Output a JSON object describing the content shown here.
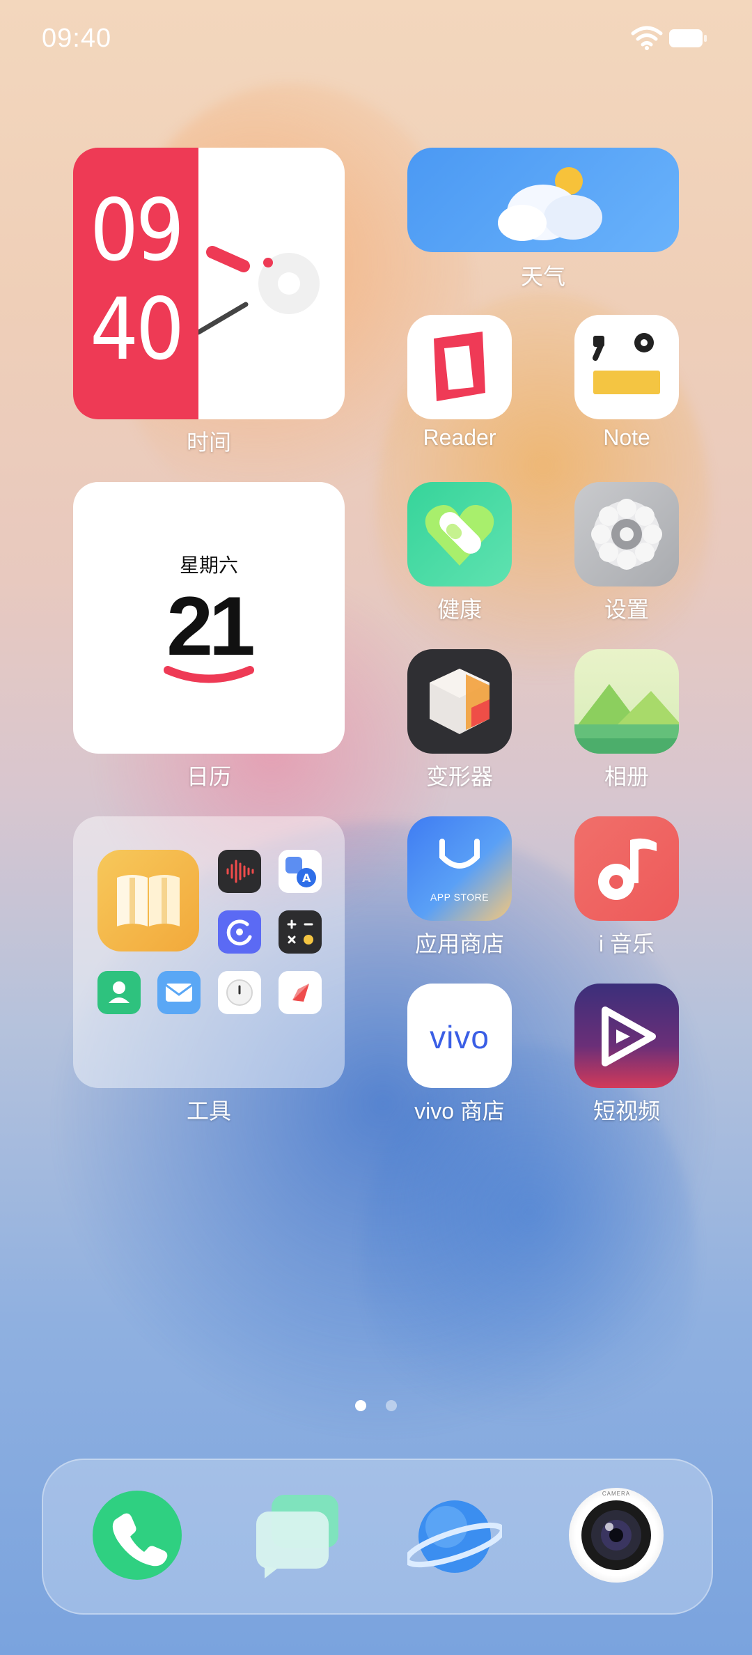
{
  "status": {
    "time": "09:40"
  },
  "widgets": {
    "clock": {
      "hour": "09",
      "minute": "40",
      "label": "时间"
    },
    "weather": {
      "label": "天气"
    },
    "calendar": {
      "weekday": "星期六",
      "day": "21",
      "label": "日历"
    },
    "tools_folder": {
      "label": "工具"
    }
  },
  "apps": [
    {
      "id": "reader",
      "label": "Reader"
    },
    {
      "id": "note",
      "label": "Note"
    },
    {
      "id": "health",
      "label": "健康"
    },
    {
      "id": "settings",
      "label": "设置"
    },
    {
      "id": "transformer",
      "label": "变形器"
    },
    {
      "id": "gallery",
      "label": "相册"
    },
    {
      "id": "app-store",
      "label": "应用商店",
      "badge_text": "APP STORE"
    },
    {
      "id": "music",
      "label": "i 音乐"
    },
    {
      "id": "vivo-store",
      "label": "vivo 商店",
      "logo_text": "vivo"
    },
    {
      "id": "short-video",
      "label": "短视频"
    }
  ],
  "dock": {
    "items": [
      {
        "id": "phone",
        "icon": "phone-icon"
      },
      {
        "id": "messages",
        "icon": "messages-icon"
      },
      {
        "id": "browser",
        "icon": "browser-icon"
      },
      {
        "id": "camera",
        "icon": "camera-icon",
        "lens_text": "CAMERA"
      }
    ]
  },
  "pages": {
    "count": 2,
    "current": 1
  },
  "colors": {
    "clock_red": "#ee3a55",
    "weather_blue": "#4f9df5",
    "health_green": "#3fd6a0",
    "music_red": "#f06363",
    "phone_green": "#2fd081"
  }
}
